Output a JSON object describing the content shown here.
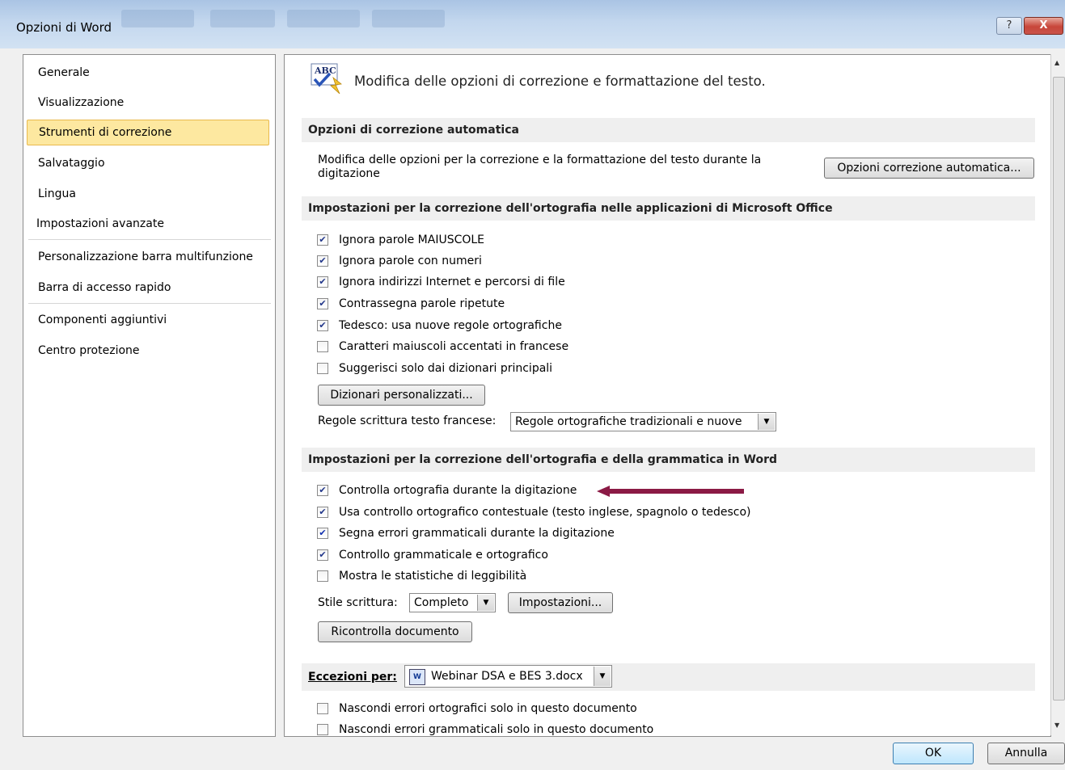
{
  "window": {
    "title": "Opzioni di Word",
    "help": "?",
    "close": "X"
  },
  "nav": {
    "items": [
      "Generale",
      "Visualizzazione",
      "Strumenti di correzione",
      "Salvataggio",
      "Lingua",
      "Impostazioni avanzate",
      "Personalizzazione barra multifunzione",
      "Barra di accesso rapido",
      "Componenti aggiuntivi",
      "Centro protezione"
    ],
    "selected": "Strumenti di correzione"
  },
  "header": {
    "icon_text": "ABC",
    "text": "Modifica delle opzioni di correzione e formattazione del testo."
  },
  "autocorrect": {
    "section": "Opzioni di correzione automatica",
    "description": "Modifica delle opzioni per la correzione e la formattazione del testo durante la digitazione",
    "button": "Opzioni correzione automatica..."
  },
  "office_spelling": {
    "section": "Impostazioni per la correzione dell'ortografia nelle applicazioni di Microsoft Office",
    "options": [
      {
        "label": "Ignora parole MAIUSCOLE",
        "checked": true
      },
      {
        "label": "Ignora parole con numeri",
        "checked": true
      },
      {
        "label": "Ignora indirizzi Internet e percorsi di file",
        "checked": true
      },
      {
        "label": "Contrassegna parole ripetute",
        "checked": true
      },
      {
        "label": "Tedesco: usa nuove regole ortografiche",
        "checked": true
      },
      {
        "label": "Caratteri maiuscoli accentati in francese",
        "checked": false
      },
      {
        "label": "Suggerisci solo dai dizionari principali",
        "checked": false
      }
    ],
    "dict_button": "Dizionari personalizzati...",
    "french_label": "Regole scrittura testo francese:",
    "french_value": "Regole ortografiche tradizionali e nuove"
  },
  "word_spelling": {
    "section": "Impostazioni per la correzione dell'ortografia e della grammatica in Word",
    "options": [
      {
        "label": "Controlla ortografia durante la digitazione",
        "checked": true
      },
      {
        "label": "Usa controllo ortografico contestuale (testo inglese, spagnolo o tedesco)",
        "checked": true
      },
      {
        "label": "Segna errori grammaticali durante la digitazione",
        "checked": true
      },
      {
        "label": "Controllo grammaticale e ortografico",
        "checked": true
      },
      {
        "label": "Mostra le statistiche di leggibilità",
        "checked": false
      }
    ],
    "style_label": "Stile scrittura:",
    "style_value": "Completo",
    "settings_button": "Impostazioni...",
    "recheck_button": "Ricontrolla documento"
  },
  "exceptions": {
    "label": "Eccezioni per:",
    "document": "Webinar DSA e BES 3.docx",
    "options": [
      {
        "label": "Nascondi errori ortografici solo in questo documento",
        "checked": false
      },
      {
        "label": "Nascondi errori grammaticali solo in questo documento",
        "checked": false
      }
    ]
  },
  "footer": {
    "ok": "OK",
    "cancel": "Annulla"
  },
  "colors": {
    "arrow": "#8b1a45",
    "selected_bg": "#fde8a0",
    "selected_border": "#e9b94c"
  }
}
